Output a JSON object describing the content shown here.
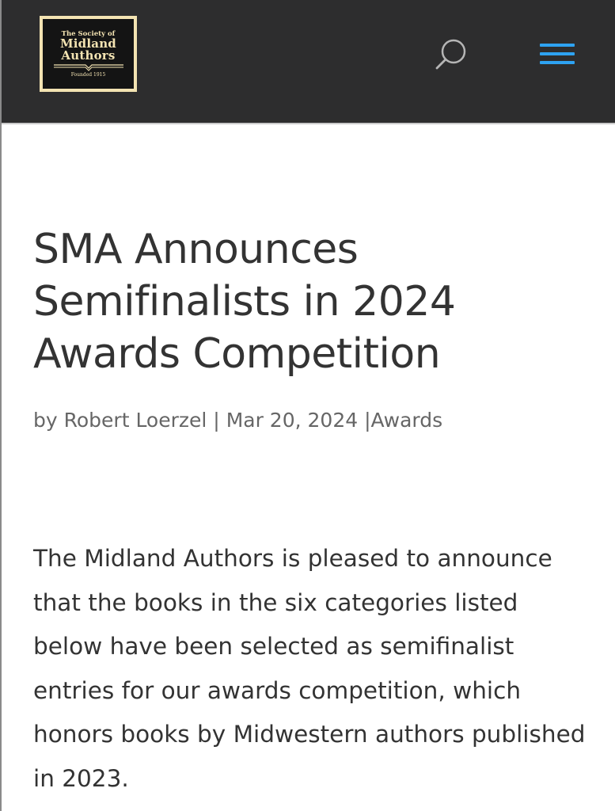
{
  "header": {
    "logo": {
      "line1": "The Society of",
      "line2": "Midland",
      "line3": "Authors",
      "line4": "Founded 1915"
    },
    "icons": {
      "search": "search-icon",
      "menu": "hamburger-menu-icon"
    },
    "colors": {
      "background": "#2d2d2e",
      "accent": "#2ea3f2",
      "logo_gold": "#f3e3b2"
    }
  },
  "article": {
    "title": "SMA Announces Semifinalists in 2024 Awards Competition",
    "meta": {
      "by": "by",
      "author": "Robert Loerzel",
      "separator": "|",
      "date": "Mar 20, 2024",
      "category": "Awards"
    },
    "body": "The Midland Authors is pleased to announce that the books in the six categories listed below have been selected as semifinalist entries for our awards competition, which honors books by Midwestern authors published in 2023."
  }
}
